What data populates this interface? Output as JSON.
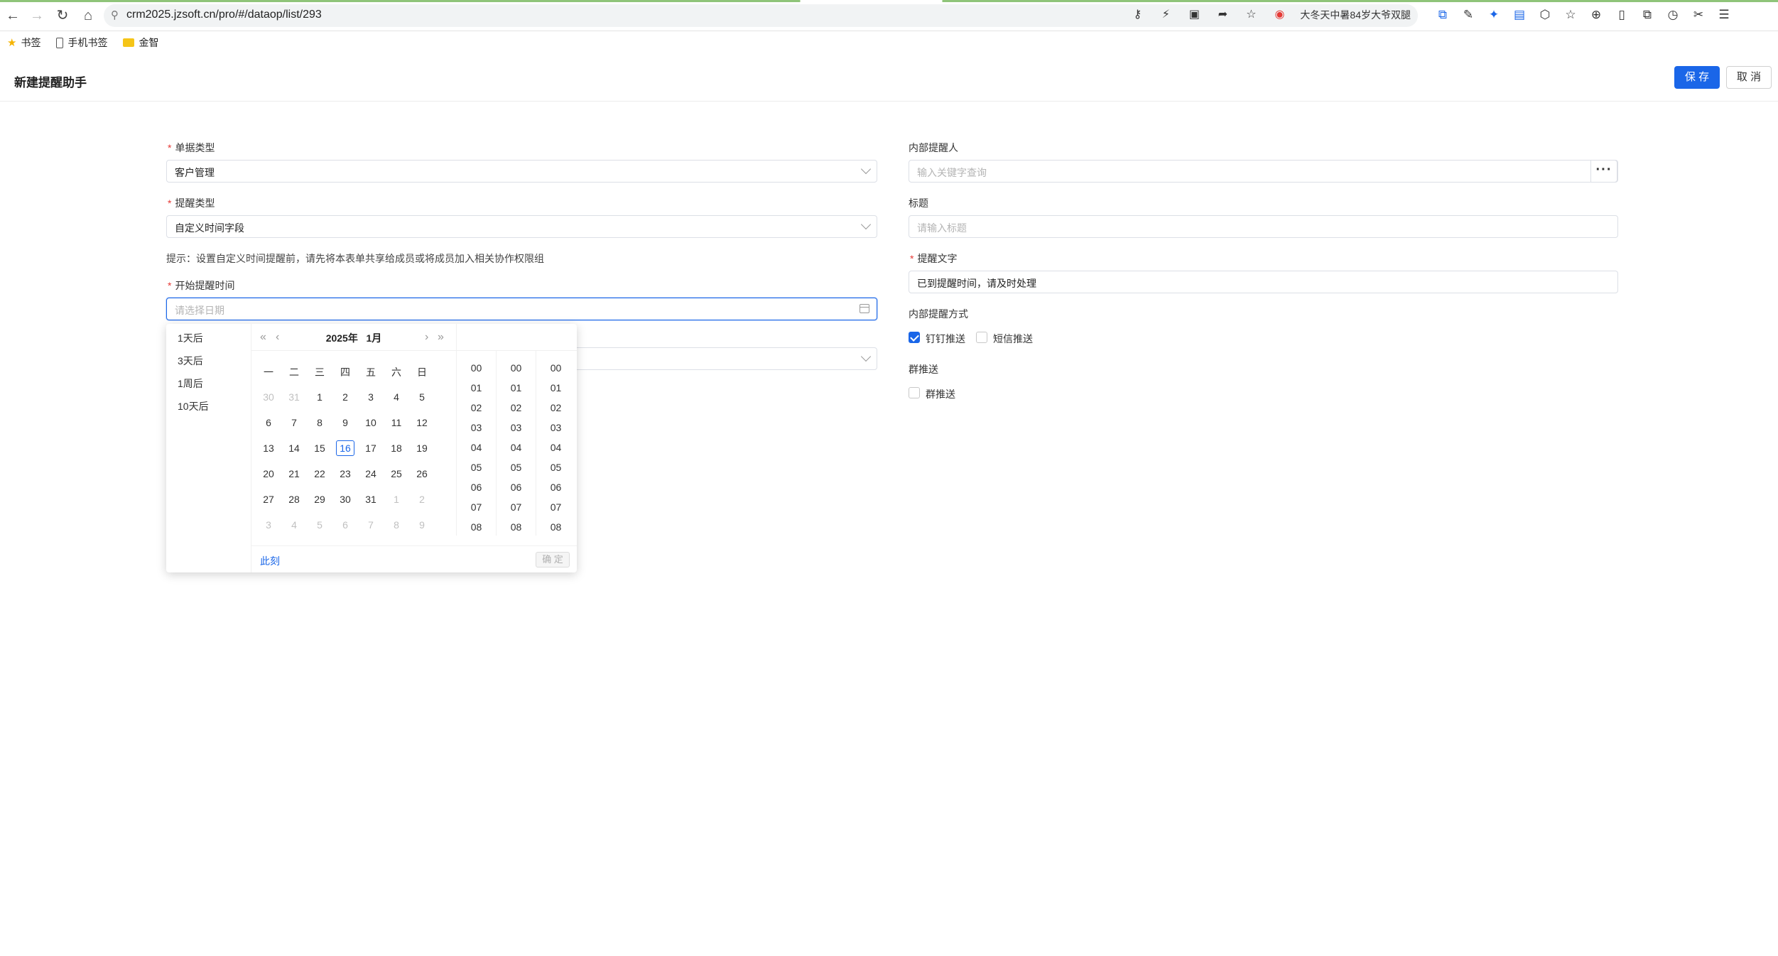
{
  "browser": {
    "url": "crm2025.jzsoft.cn/pro/#/dataop/list/293",
    "news_text": "大冬天中暑84岁大爷双腿",
    "bookmarks": [
      {
        "label": "书签",
        "icon": "star-icon"
      },
      {
        "label": "手机书签",
        "icon": "phone-icon"
      },
      {
        "label": "金智",
        "icon": "folder-icon"
      }
    ]
  },
  "header": {
    "title": "新建提醒助手",
    "save_label": "保 存",
    "cancel_label": "取 消"
  },
  "form": {
    "doc_type": {
      "label": "单据类型",
      "value": "客户管理"
    },
    "remind_type": {
      "label": "提醒类型",
      "value": "自定义时间字段"
    },
    "hint": "提示：设置自定义时间提醒前，请先将本表单共享给成员或将成员加入相关协作权限组",
    "start_time": {
      "label": "开始提醒时间",
      "placeholder": "请选择日期"
    },
    "internal_reminder": {
      "label": "内部提醒人",
      "placeholder": "输入关键字查询"
    },
    "title_field": {
      "label": "标题",
      "placeholder": "请输入标题"
    },
    "remind_text": {
      "label": "提醒文字",
      "value": "已到提醒时间，请及时处理"
    },
    "remind_method": {
      "label": "内部提醒方式",
      "options": [
        {
          "label": "钉钉推送",
          "checked": true
        },
        {
          "label": "短信推送",
          "checked": false
        }
      ]
    },
    "group_push": {
      "label": "群推送",
      "option": "群推送",
      "checked": false
    }
  },
  "date_picker": {
    "presets": [
      "1天后",
      "3天后",
      "1周后",
      "10天后"
    ],
    "year_label": "2025年",
    "month_label": "1月",
    "weekdays": [
      "一",
      "二",
      "三",
      "四",
      "五",
      "六",
      "日"
    ],
    "days": [
      [
        "30",
        "31",
        "1",
        "2",
        "3",
        "4",
        "5"
      ],
      [
        "6",
        "7",
        "8",
        "9",
        "10",
        "11",
        "12"
      ],
      [
        "13",
        "14",
        "15",
        "16",
        "17",
        "18",
        "19"
      ],
      [
        "20",
        "21",
        "22",
        "23",
        "24",
        "25",
        "26"
      ],
      [
        "27",
        "28",
        "29",
        "30",
        "31",
        "1",
        "2"
      ],
      [
        "3",
        "4",
        "5",
        "6",
        "7",
        "8",
        "9"
      ]
    ],
    "muted": [
      [
        0,
        0
      ],
      [
        0,
        1
      ],
      [
        4,
        5
      ],
      [
        4,
        6
      ],
      [
        5,
        0
      ],
      [
        5,
        1
      ],
      [
        5,
        2
      ],
      [
        5,
        3
      ],
      [
        5,
        4
      ],
      [
        5,
        5
      ],
      [
        5,
        6
      ]
    ],
    "today": "16",
    "time_values": [
      "00",
      "01",
      "02",
      "03",
      "04",
      "05",
      "06",
      "07",
      "08"
    ],
    "now_label": "此刻",
    "ok_label": "确 定"
  }
}
